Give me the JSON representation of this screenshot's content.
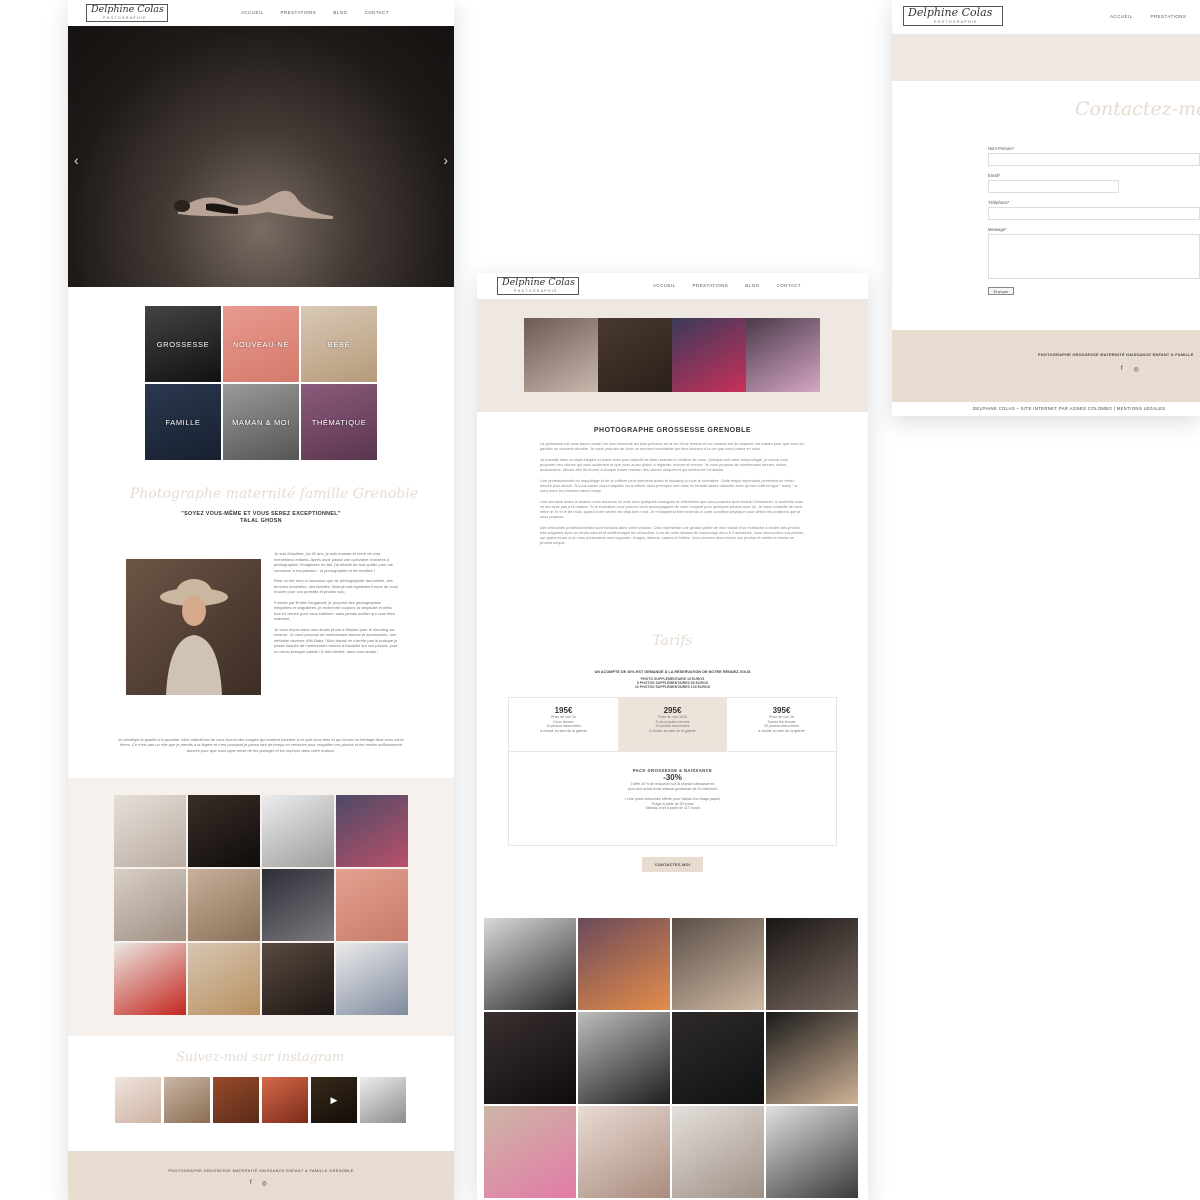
{
  "brand": {
    "logo_script": "Delphine Colas",
    "logo_sub": "PHOTOGRAPHIE"
  },
  "nav": {
    "items": [
      "ACCUEIL",
      "PRESTATIONS",
      "BLOG",
      "CONTACT"
    ]
  },
  "icons": {
    "arrow_left": "‹",
    "arrow_right": "›",
    "facebook": "f",
    "instagram": "◎",
    "play": "▶"
  },
  "home": {
    "categories": [
      "GROSSESSE",
      "NOUVEAU-NÉ",
      "BÉBÉ",
      "FAMILLE",
      "MAMAN & MOI",
      "THÉMATIQUE"
    ],
    "script_title": "Photographe maternité famille Grenoble",
    "quote": "\"SOYEZ VOUS-MÊME ET VOUS SEREZ EXCEPTIONNEL\"",
    "quote_author": "TALAL GHOSN",
    "bio": [
      "Je suis Delphine, j'ai 40 ans, je suis maman et mère de cinq merveilleux enfants. Après avoir passé une quinzaine d'années à photographier l'imaginaire en fait, j'ai décidé de tout quitter pour me consacrer à ma passion : la photographie et les familles !",
      "Rien ne me rend si heureuse que de photographier des bébés, des femmes enceintes, des familles. Mais je suis également noue de vous trouver pour vos portraits et photos solo.",
      "Formée par Emilie Zanganelli, je propose des photographies élégantes et singulières, je recherche toujours la simplicité et mets tout en œuvre pour vous sublimer, sans jamais oublier qui vous êtes vraiment.",
      "Je vous reçois dans mon studio photo à Meylan pour le shooting sur mesure. Je vous propose de nombreuses tenues et accessoires, une véritable caverne d'Ali Baba ! Mon travail ne s'arrête pas là puisque je passe ensuite de nombreuses heures à travailler sur vos photos, pour un rendu presque parfait ! À très bientôt, dans mon studio !"
    ],
    "bio_foot": "Je privilégie la qualité à la quantité. Mon objectif est de vous fournir des images qui rendent honneur à ce que vous êtes et qui seront un héritage dont vous serez fières. Ce n'est pas un rôle que je prends à la légère et c'est pourquoi je passe tant de temps en retouche pour magnifier vos photos et les rendre suffisamment douces pour que vous ayez envie de les partager et les imposer dans votre maison.",
    "instagram_title": "Suivez-moi sur instagram",
    "footer_text": "PHOTOGRAPHE GROSSESSE MATERNITÉ NAISSANCE ENFANT & FAMILLE GRENOBLE"
  },
  "prestations": {
    "title": "PHOTOGRAPHE GROSSESSE GRENOBLE",
    "paragraphs": [
      "La grossesse est sans aucun doute l'un des moments les plus précieux de la vie d'une femme et ma mission est de capturer cet instant pour que vous en gardiez un souvenir durable. Je vous propose de vivre un moment inoubliable qui fera honneur à la vie que vous portez en vous.",
      "Je travaille dans un style élégant et sobre avec pour objectif de faire ressortir le meilleur de vous. Quelque soit votre morphologie, je saurai vous proposer des clichés qui vous subliment et que vous aurez plaisir à regarder, encore et encore. Je vous propose de nombreuses tenues, voiles, accessoires, décors afin de fournir à chaque future maman des clichés uniques et qui sortent de l'ordinaire.",
      "Une professionnelle du maquillage et de la coiffure peut intervenir avant le shooting si vous le souhaitez. Cette étape importante permettra un rendu encore plus abouti. Si vous savez vous maquiller vous-même alors prévoyez une mise en beauté assez naturelle avec qu'une coiffure type \" wavy \" si vous avez les cheveux assez longs.",
      "Une semaine avant la séance nous trouvons un mail avec quelques consignes et vêtements que vous pourriez avoir besoin d'emmener, si toutefois vous ne les avez pas à la maison. Si le souhaitez vous pouvez venir accompagnée de votre conjoint pour quelques photos avec lui. Je vous conseille de venir entre le 7e et le 8e mois, quand votre ventre est déjà bien rond. Je m'adapterai bien entendu à votre condition physique pour définir les positions que je vous propose.",
      "Des retouches professionnelles sont incluses dans votre session. Cela représente une grosse partie de mon travail et je m'attache à rendre des photos très soignées avec un rendu naturel et subtil images lec retouches. Lors de notre séance de visionnage deux à 3 semaines, vous découvrirez vos photos sur grand écran et je vous présenterai mes supports : tirages, albums, cadres et boîtes. Vous pourrez ainsi choisir vos photos et mettre en forme un produit unique."
    ],
    "tarifs_title": "Tarifs",
    "deposit": "UN ACOMPTE DE 30% EST DEMANDÉ À LA RÉSERVATION DE NOTRE RENDEZ-VOUS",
    "photo_extra": [
      "PHOTO SUPPLÉMENTAIRE 15 EUROS",
      "5 PHOTOS SUPPLÉMENTAIRES 60 EUROS",
      "10 PHOTOS SUPPLÉMENTAIRES 100 EUROS"
    ],
    "prices": [
      {
        "amount": "195€",
        "lines": [
          "Prise de vue 1h",
          "Deux tenues",
          "10 photos retouchées",
          "à choisir au sein de la galerie"
        ]
      },
      {
        "amount": "295€",
        "lines": [
          "Prise de vue 1h30",
          "Trois à quatre tenues",
          "15 photos retouchées",
          "à choisir au sein de la galerie"
        ]
      },
      {
        "amount": "395€",
        "lines": [
          "Prise de vue 2h",
          "Toutes les tenues",
          "20 photos retouchées",
          "à choisir au sein de la galerie"
        ]
      }
    ],
    "pack": {
      "title": "PACK GROSSESSE & NAISSANCE",
      "percent": "-30%",
      "lines": [
        "J'offre 30 % de réduction sur la séance naissance en",
        "pour tout achat d'une séance grossesse de 2h minimum"
      ],
      "extra": [
        "• Une photo retouchée offerte pour l'achat d'un tirage papier",
        "Tirage à partir de 30 euros",
        "Tableau d'art à partir de 117 euros"
      ]
    },
    "contact_button": "CONTACTEZ-MOI"
  },
  "contact": {
    "title": "Contactez-moi",
    "fields": [
      {
        "label": "Nom Prénom*"
      },
      {
        "label": "Email*"
      },
      {
        "label": "Téléphone*"
      },
      {
        "label": "Message*"
      }
    ],
    "submit": "Envoyer",
    "footer_text": "PHOTOGRAPHE GROSSESSE MATERNITÉ NAISSANCE ENFANT & FAMILLE",
    "credits": "DELPHINE COLAS – SITE INTERNET PAR AGNES COLOMBO | MENTIONS LÉGALES"
  },
  "colors": {
    "accent": "#e8dcd1",
    "band": "#efe8e2",
    "text": "#333333"
  }
}
